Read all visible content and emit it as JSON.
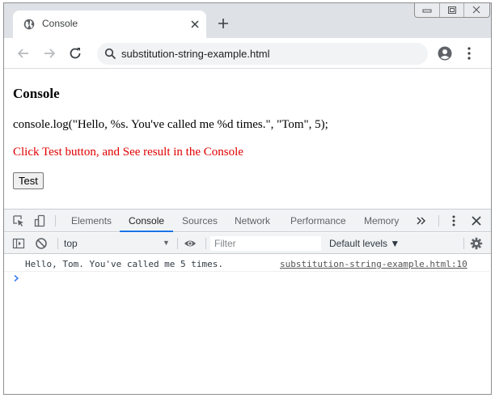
{
  "tab": {
    "title": "Console"
  },
  "address_bar": {
    "url": "substitution-string-example.html"
  },
  "page": {
    "heading": "Console",
    "code": "console.log(\"Hello, %s. You've called me %d times.\", \"Tom\", 5);",
    "hint": "Click Test button, and See result in the Console",
    "button_label": "Test"
  },
  "devtools": {
    "tabs": [
      "Elements",
      "Console",
      "Sources",
      "Network",
      "Performance",
      "Memory"
    ],
    "active_tab": "Console",
    "context": "top",
    "filter_placeholder": "Filter",
    "levels": "Default levels ▼",
    "messages": [
      {
        "text": "Hello, Tom. You've called me 5 times.",
        "source": "substitution-string-example.html:10"
      }
    ]
  },
  "colors": {
    "hint_red": "#e00000",
    "active_tab_blue": "#1a73e8",
    "prompt_blue": "#367cf1"
  },
  "icons": [
    "globe-icon",
    "close-icon",
    "plus-icon",
    "back-icon",
    "forward-icon",
    "reload-icon",
    "search-icon",
    "profile-icon",
    "menu-icon",
    "inspect-icon",
    "device-icon",
    "more-tabs-icon",
    "kebab-icon",
    "sidebar-icon",
    "clear-icon",
    "eye-icon",
    "gear-icon",
    "prompt-icon"
  ]
}
